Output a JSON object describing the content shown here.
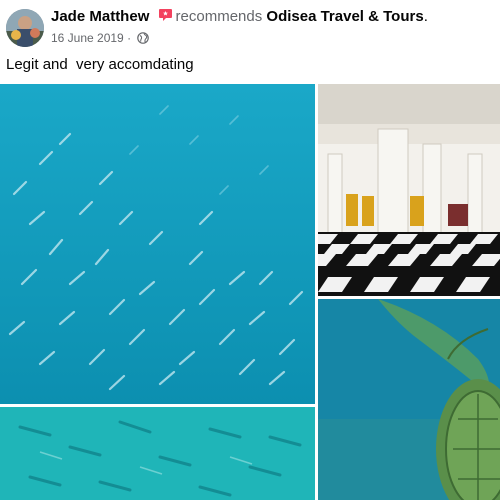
{
  "post": {
    "author": "Jade Matthew",
    "action": "recommends",
    "page_name": "Odisea Travel & Tours",
    "page_name_suffix": ".",
    "date": "16 June 2019",
    "separator": " · ",
    "privacy_icon": "globe-icon",
    "recommend_icon": "recommend-badge-icon",
    "text": "Legit and  very accomdating"
  },
  "photos": [
    {
      "subject": "school of fish underwater"
    },
    {
      "subject": "building interior with checkered floor"
    },
    {
      "subject": "school of fish close-up"
    },
    {
      "subject": "sea turtle swimming"
    }
  ],
  "colors": {
    "recommend_red": "#f3425f",
    "meta_grey": "#65676b",
    "text": "#050505"
  }
}
